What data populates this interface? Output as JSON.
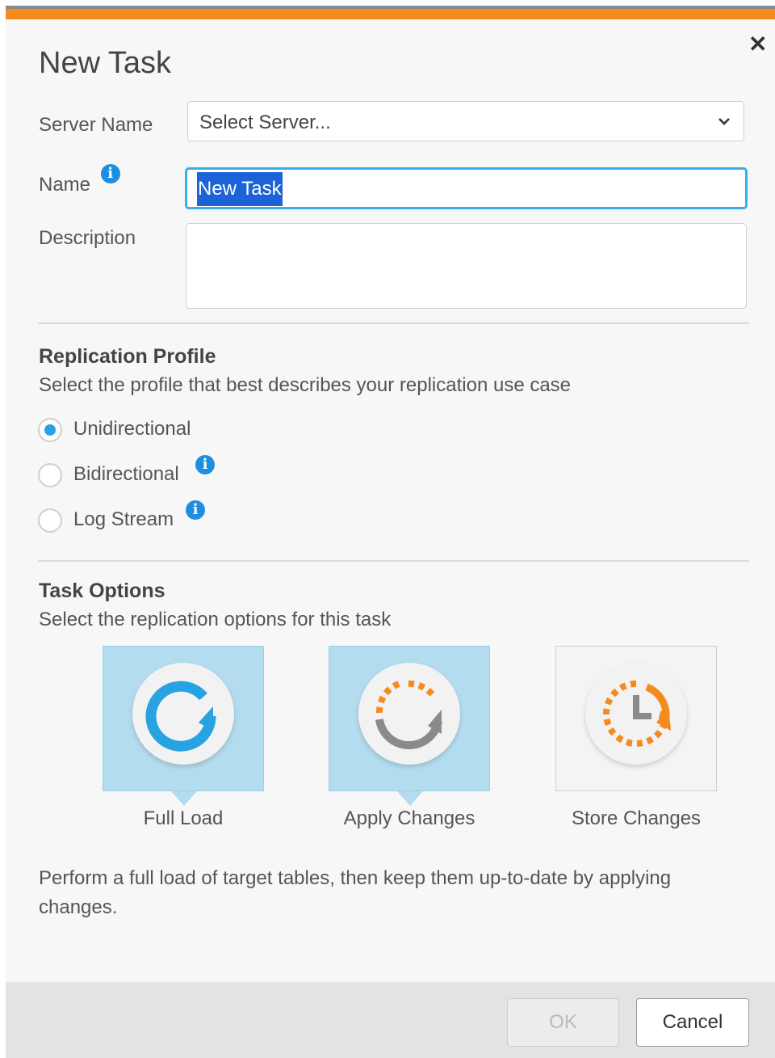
{
  "dialog": {
    "title": "New Task",
    "close_icon": "close-icon",
    "accent_color": "#f58b1f"
  },
  "form": {
    "server_label": "Server Name",
    "server_value": "Select Server...",
    "name_label": "Name",
    "name_value": "New Task",
    "description_label": "Description",
    "description_value": ""
  },
  "replication_profile": {
    "title": "Replication Profile",
    "subtitle": "Select the profile that best describes your replication use case",
    "options": [
      {
        "label": "Unidirectional",
        "selected": true,
        "info": false
      },
      {
        "label": "Bidirectional",
        "selected": false,
        "info": true
      },
      {
        "label": "Log Stream",
        "selected": false,
        "info": true
      }
    ]
  },
  "task_options": {
    "title": "Task Options",
    "subtitle": "Select the replication options for this task",
    "tiles": [
      {
        "label": "Full Load",
        "active": true,
        "icon": "full-load-icon"
      },
      {
        "label": "Apply Changes",
        "active": true,
        "icon": "apply-changes-icon"
      },
      {
        "label": "Store Changes",
        "active": false,
        "icon": "store-changes-icon"
      }
    ],
    "description": "Perform a full load of target tables, then keep them up-to-date by applying changes."
  },
  "footer": {
    "ok_label": "OK",
    "ok_enabled": false,
    "cancel_label": "Cancel"
  }
}
